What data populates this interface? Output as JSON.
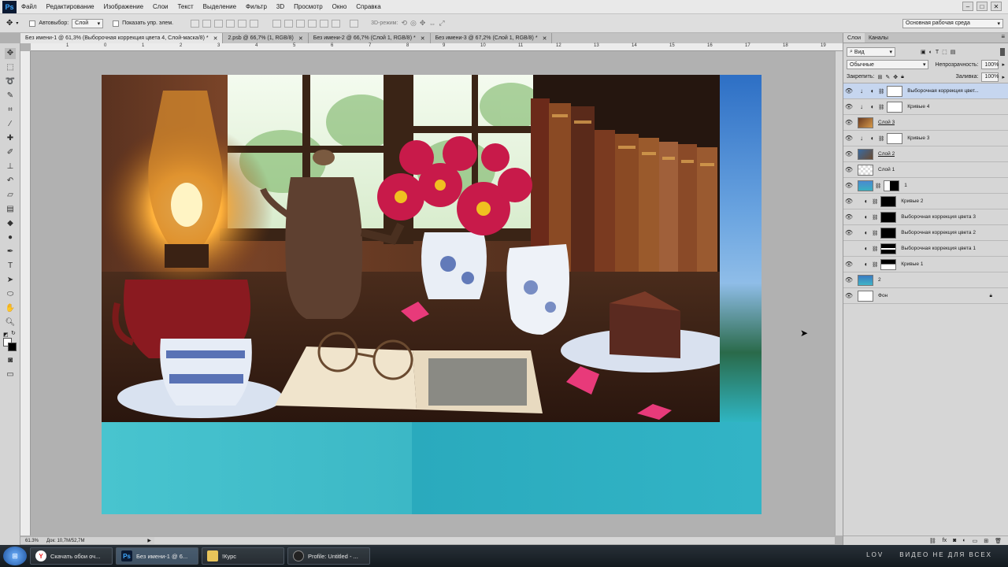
{
  "menubar": {
    "logo": "Ps",
    "items": [
      "Файл",
      "Редактирование",
      "Изображение",
      "Слои",
      "Текст",
      "Выделение",
      "Фильтр",
      "3D",
      "Просмотр",
      "Окно",
      "Справка"
    ]
  },
  "options": {
    "autoselect_label": "Автовыбор:",
    "autoselect_value": "Слой",
    "show_controls_label": "Показать упр. элем.",
    "mode3d_label": "3D-режим:",
    "workspace": "Основная рабочая среда"
  },
  "doc_tabs": [
    {
      "label": "Без имени-1 @ 61,3% (Выборочная коррекция цвета 4, Слой-маска/8) *",
      "active": true
    },
    {
      "label": "2.psb @ 66,7% (1, RGB/8)",
      "active": false
    },
    {
      "label": "Без имени-2 @ 66,7% (Слой 1, RGB/8) *",
      "active": false
    },
    {
      "label": "Без имени-3 @ 67,2% (Слой 1, RGB/8) *",
      "active": false
    }
  ],
  "ruler_ticks": [
    "1",
    "0",
    "1",
    "2",
    "3",
    "4",
    "5",
    "6",
    "7",
    "8",
    "9",
    "10",
    "11",
    "12",
    "13",
    "14",
    "15",
    "16",
    "17",
    "18",
    "19"
  ],
  "status": {
    "zoom": "61.3%",
    "doc": "Док: 10,7M/52,7M"
  },
  "panel": {
    "tabs": [
      "Слои",
      "Каналы"
    ],
    "kind_label": "Вид",
    "blend_mode": "Обычные",
    "opacity_label": "Непрозрачность:",
    "opacity_value": "100%",
    "lock_label": "Закрепить:",
    "fill_label": "Заливка:",
    "fill_value": "100%",
    "layers": [
      {
        "name": "Выборочная коррекция цвет...",
        "selected": true
      },
      {
        "name": "Кривые 4"
      },
      {
        "name": "Слой 3"
      },
      {
        "name": "Кривые 3"
      },
      {
        "name": "Слой 2"
      },
      {
        "name": "Слой 1"
      },
      {
        "name": "1"
      },
      {
        "name": "Кривые 2"
      },
      {
        "name": "Выборочная коррекция цвета 3"
      },
      {
        "name": "Выборочная коррекция цвета 2"
      },
      {
        "name": "Выборочная коррекция цвета 1"
      },
      {
        "name": "Кривые 1"
      },
      {
        "name": "2"
      },
      {
        "name": "Фон"
      }
    ]
  },
  "taskbar": {
    "items": [
      {
        "label": "Скачать обои оч...",
        "icon": "yandex-browser-icon"
      },
      {
        "label": "Без имени-1 @ 6...",
        "icon": "photoshop-icon"
      },
      {
        "label": "!Курс",
        "icon": "folder-icon"
      },
      {
        "label": "Profile: Untitled - ...",
        "icon": "app-icon"
      }
    ],
    "brand": "LOV",
    "slogan": "ВИДЕО НЕ ДЛЯ ВСЕХ"
  }
}
